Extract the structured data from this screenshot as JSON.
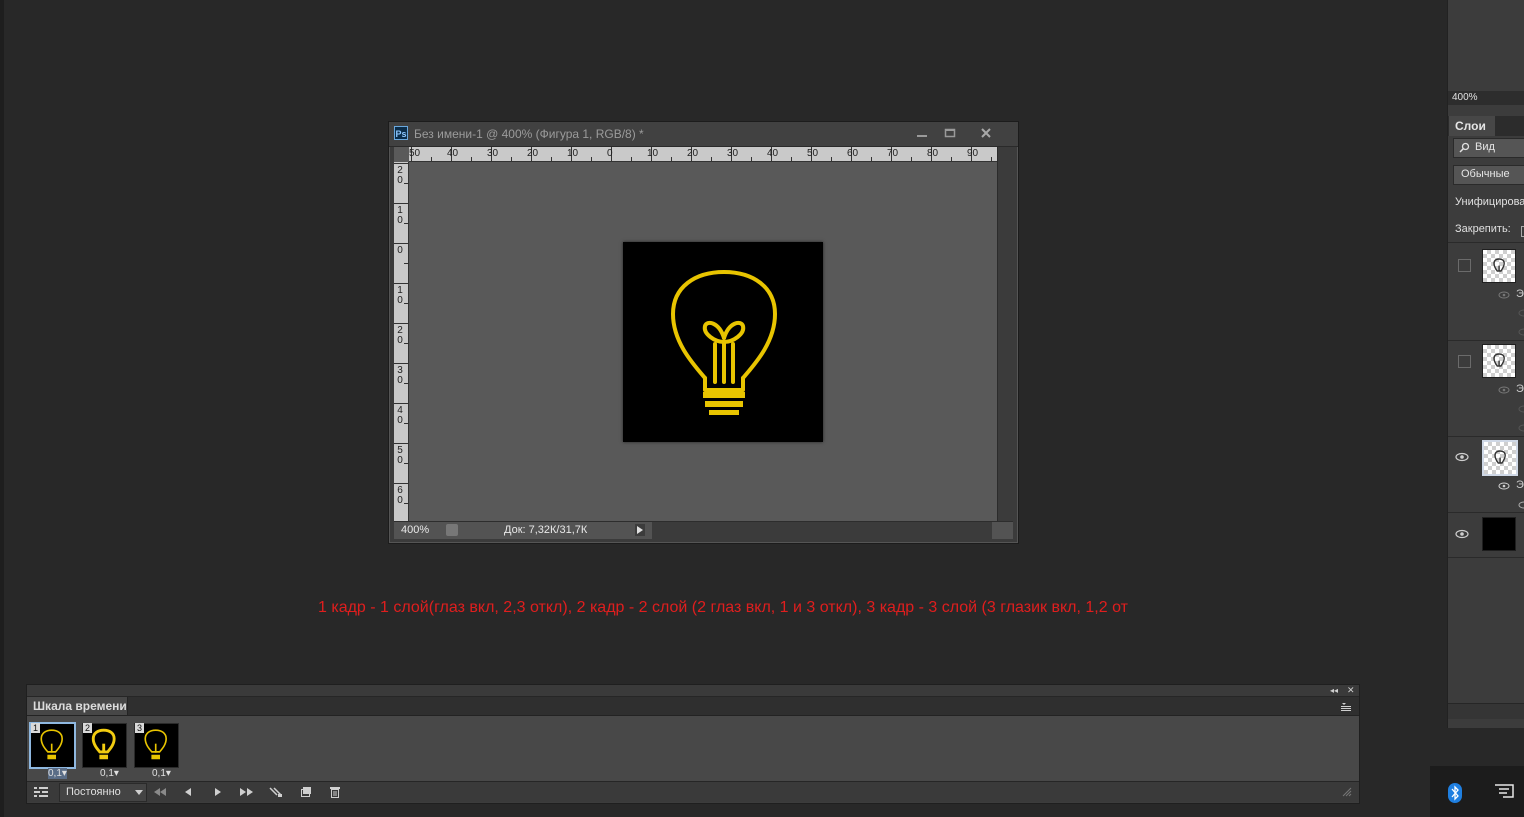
{
  "document": {
    "title": "Без имени-1 @ 400% (Фигура 1, RGB/8) *",
    "app_icon": "Ps",
    "zoom": "400%",
    "doc_info": "Док: 7,32К/31,7К",
    "hruler_labels": [
      "50",
      "40",
      "30",
      "20",
      "10",
      "0",
      "10",
      "20",
      "30",
      "40",
      "50",
      "60",
      "70",
      "80",
      "90"
    ],
    "vruler_labels": [
      [
        "2",
        "0"
      ],
      [
        "1",
        "0"
      ],
      [
        "0"
      ],
      [
        "1",
        "0"
      ],
      [
        "2",
        "0"
      ],
      [
        "3",
        "0"
      ],
      [
        "4",
        "0"
      ],
      [
        "5",
        "0"
      ],
      [
        "6",
        "0"
      ]
    ]
  },
  "annotation": "1 кадр - 1 слой(глаз вкл, 2,3 откл), 2 кадр - 2 слой (2 глаз вкл, 1 и 3 откл), 3 кадр - 3 слой (3 глазик вкл, 1,2 от",
  "timeline": {
    "tab": "Шкала времени",
    "frames": [
      {
        "number": "1",
        "delay": "0,1▾"
      },
      {
        "number": "2",
        "delay": "0,1▾"
      },
      {
        "number": "3",
        "delay": "0,1▾"
      }
    ],
    "loop": "Постоянно"
  },
  "layers_panel": {
    "zoom": "400%",
    "tab": "Слои",
    "search": "Вид",
    "blend_mode": "Обычные",
    "unify": "Унифицирова",
    "lock": "Закрепить:",
    "effect_letter": "Э"
  },
  "colors": {
    "bulb": "#e8c400",
    "annotation": "#e01e1e",
    "selection": "#8fb8e0"
  },
  "icons": [
    "minimize-icon",
    "maximize-icon",
    "close-icon",
    "eye-icon",
    "search-icon",
    "bluetooth-icon",
    "notification-icon",
    "play-icon",
    "trash-icon"
  ]
}
